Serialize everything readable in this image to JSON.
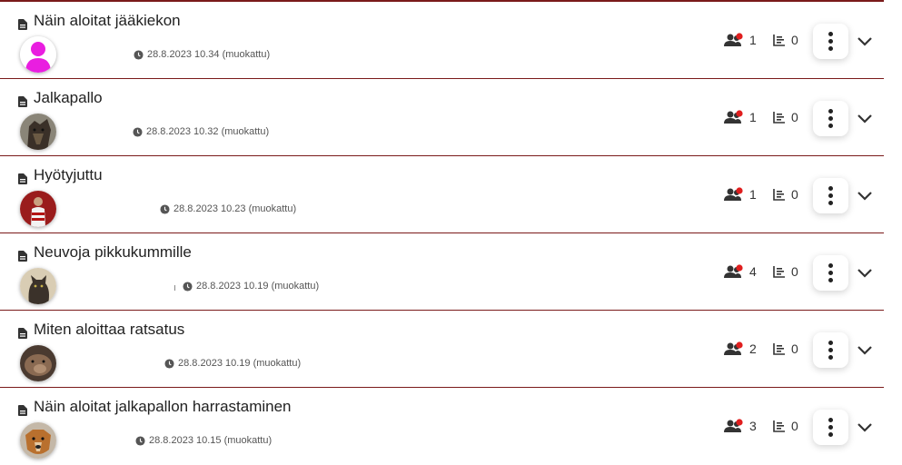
{
  "rows": [
    {
      "title": "Näin aloitat jääkiekon",
      "timestamp": "28.8.2023 10.34 (muokattu)",
      "participants": "1",
      "results": "0",
      "avatar": "pink-person-avatar"
    },
    {
      "title": "Jalkapallo",
      "timestamp": "28.8.2023 10.32 (muokattu)",
      "participants": "1",
      "results": "0",
      "avatar": "dog-photo-avatar"
    },
    {
      "title": "Hyötyjuttu",
      "timestamp": "28.8.2023 10.23 (muokattu)",
      "participants": "1",
      "results": "0",
      "avatar": "football-player-avatar"
    },
    {
      "title": "Neuvoja pikkukummille",
      "timestamp": "28.8.2023 10.19 (muokattu)",
      "participants": "4",
      "results": "0",
      "avatar": "cat-photo-avatar"
    },
    {
      "title": "Miten aloittaa ratsatus",
      "timestamp": "28.8.2023 10.19 (muokattu)",
      "participants": "2",
      "results": "0",
      "avatar": "animal-photo-avatar"
    },
    {
      "title": "Näin aloitat jalkapallon harrastaminen",
      "timestamp": "28.8.2023 10.15 (muokattu)",
      "participants": "3",
      "results": "0",
      "avatar": "dog-photo-avatar"
    }
  ],
  "colors": {
    "divider": "#7a1a1a",
    "notify_dot": "#e01e1e",
    "avatar_pink": "#e91ee0"
  }
}
